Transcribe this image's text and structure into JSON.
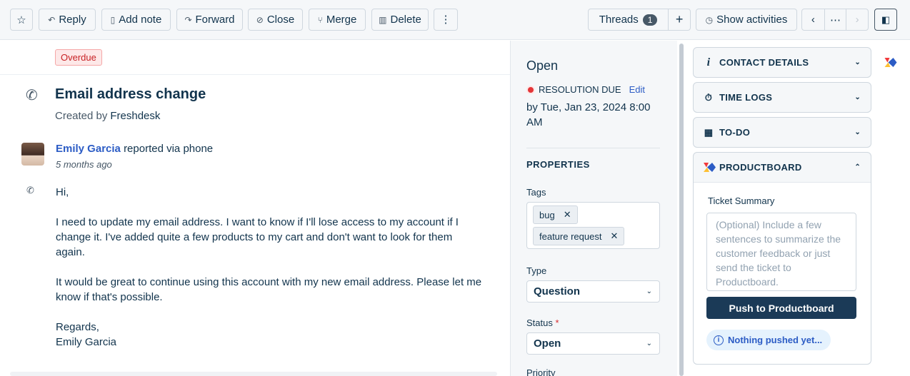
{
  "toolbar": {
    "reply": "Reply",
    "add_note": "Add note",
    "forward": "Forward",
    "close": "Close",
    "merge": "Merge",
    "delete": "Delete",
    "threads": "Threads",
    "threads_count": "1",
    "show_activities": "Show activities"
  },
  "ticket": {
    "overdue": "Overdue",
    "title": "Email address change",
    "created_by_label": "Created by",
    "created_by": "Freshdesk",
    "author": "Emily Garcia",
    "reported": "reported via phone",
    "ago": "5 months ago",
    "body": {
      "p1": "Hi,",
      "p2": "I need to update my email address. I want to know if I'll lose access to my account if I change it. I've added quite a few products to my cart and don't want to look for them again.",
      "p3": "It would be great to continue using this account with my new email address. Please let me know if that's possible.",
      "p4a": "Regards,",
      "p4b": "Emily Garcia"
    }
  },
  "properties": {
    "status_title": "Open",
    "resolution_label": "RESOLUTION DUE",
    "edit": "Edit",
    "due_text": "by Tue, Jan 23, 2024 8:00 AM",
    "heading": "PROPERTIES",
    "tags_label": "Tags",
    "tags": [
      "bug",
      "feature request"
    ],
    "type_label": "Type",
    "type_value": "Question",
    "status_label": "Status",
    "required": "*",
    "status_value": "Open",
    "priority_label": "Priority"
  },
  "sidebar": {
    "contact": "CONTACT DETAILS",
    "time_logs": "TIME LOGS",
    "todo": "TO-DO",
    "productboard": "PRODUCTBOARD",
    "summary_label": "Ticket Summary",
    "summary_placeholder": "(Optional) Include a few sentences to summarize the customer feedback or just send the ticket to Productboard.",
    "push": "Push to Productboard",
    "nothing": "Nothing pushed yet..."
  },
  "colors": {
    "accent": "#2c5cc5",
    "overdue": "#c82124",
    "push": "#1b3a57"
  }
}
